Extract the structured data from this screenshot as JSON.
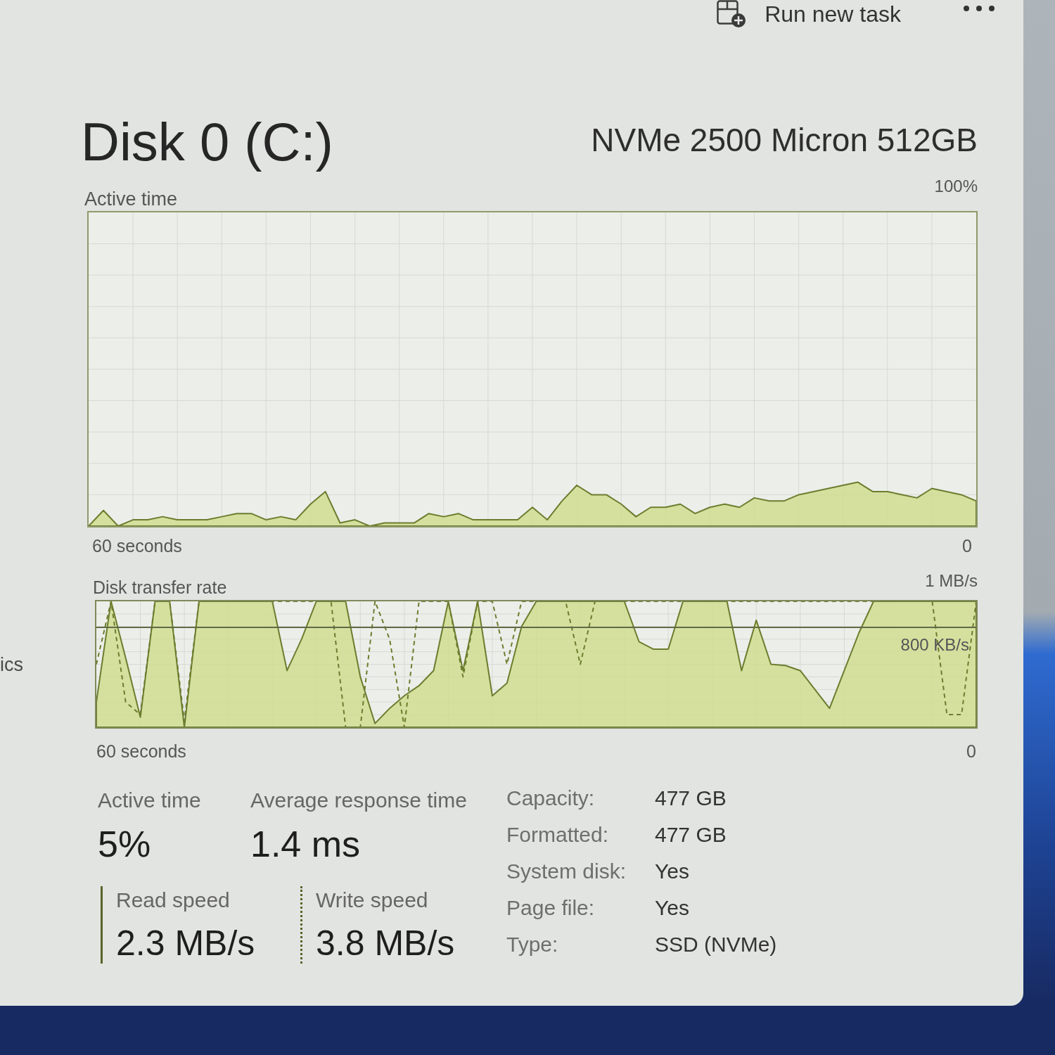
{
  "sidebar_item": "ics",
  "toolbar": {
    "run_new_task": "Run new task"
  },
  "header": {
    "title": "Disk 0 (C:)",
    "model": "NVMe 2500 Micron 512GB"
  },
  "active_time_graph": {
    "title": "Active time",
    "scale_max": "100%",
    "time_start": "60 seconds",
    "time_end": "0"
  },
  "transfer_rate_graph": {
    "title": "Disk transfer rate",
    "scale_max": "1 MB/s",
    "scale_mark": "800 KB/s",
    "time_start": "60 seconds",
    "time_end": "0"
  },
  "stats": [
    {
      "label": "Active time",
      "value": "5%"
    },
    {
      "label": "Average response time",
      "value": "1.4 ms"
    }
  ],
  "speeds": [
    {
      "label": "Read speed",
      "value": "2.3 MB/s",
      "kind": "solid"
    },
    {
      "label": "Write speed",
      "value": "3.8 MB/s",
      "kind": "dotted"
    }
  ],
  "properties": [
    {
      "label": "Capacity:",
      "value": "477 GB"
    },
    {
      "label": "Formatted:",
      "value": "477 GB"
    },
    {
      "label": "System disk:",
      "value": "Yes"
    },
    {
      "label": "Page file:",
      "value": "Yes"
    },
    {
      "label": "Type:",
      "value": "SSD (NVMe)"
    }
  ]
}
